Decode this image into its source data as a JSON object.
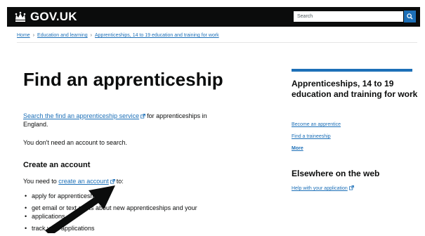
{
  "header": {
    "logo_text": "GOV.UK",
    "search_placeholder": "Search",
    "colors": {
      "header_bg": "#0b0c0c",
      "search_button": "#1d70b8"
    },
    "icons": [
      "crown-icon",
      "search-icon"
    ]
  },
  "breadcrumb": {
    "items": [
      "Home",
      "Education and learning",
      "Apprenticeships, 14 to 19 education and training for work"
    ]
  },
  "main": {
    "title": "Find an apprenticeship",
    "intro_link": "Search the find an apprenticeship service",
    "intro_rest": "for apprenticeships in",
    "intro_line2": "England.",
    "no_account": "You don't need an account to search.",
    "create_heading": "Create an account",
    "need_to_prefix": "You need to",
    "need_to_link": "create an account",
    "need_to_suffix": "to:",
    "bullets": [
      "apply for apprenticeships",
      "get email or text alerts about new apprenticeships and your",
      "applications",
      "track your applications"
    ]
  },
  "sidebar": {
    "heading": "Apprenticeships, 14 to 19 education and training for work",
    "links": [
      "Become an apprentice",
      "Find a traineeship"
    ],
    "more": "More",
    "elsewhere_heading": "Elsewhere on the web",
    "elsewhere_link": "Help with your application",
    "accent": "#1d70b8"
  },
  "colors": {
    "link": "#1d70b8",
    "text": "#0b0c0c"
  }
}
